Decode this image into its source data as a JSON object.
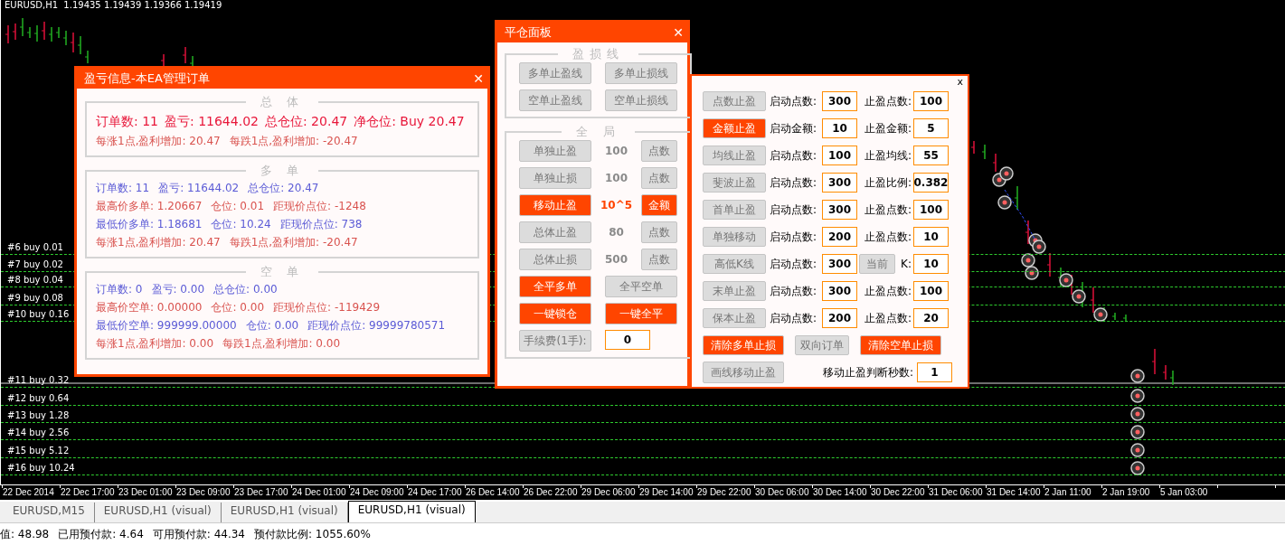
{
  "chart": {
    "title": "EURUSD,H1  1.19435 1.19439 1.19366 1.19419",
    "order_lines": [
      {
        "label": "#6 buy 0.01"
      },
      {
        "label": "#7 buy 0.02"
      },
      {
        "label": "#8 buy 0.04"
      },
      {
        "label": "#9 buy 0.08"
      },
      {
        "label": "#10 buy 0.16"
      },
      {
        "label": "#11 buy 0.32"
      },
      {
        "label": "#12 buy 0.64"
      },
      {
        "label": "#13 buy 1.28"
      },
      {
        "label": "#14 buy 2.56"
      },
      {
        "label": "#15 buy 5.12"
      },
      {
        "label": "#16 buy 10.24"
      }
    ],
    "time_axis": [
      "22 Dec 2014",
      "22 Dec 17:00",
      "23 Dec 01:00",
      "23 Dec 09:00",
      "23 Dec 17:00",
      "24 Dec 01:00",
      "24 Dec 09:00",
      "24 Dec 17:00",
      "26 Dec 14:00",
      "26 Dec 22:00",
      "29 Dec 06:00",
      "29 Dec 14:00",
      "29 Dec 22:00",
      "30 Dec 06:00",
      "30 Dec 14:00",
      "30 Dec 22:00",
      "31 Dec 06:00",
      "31 Dec 14:00",
      "2 Jan 11:00",
      "2 Jan 19:00",
      "5 Jan 03:00"
    ]
  },
  "profit_panel": {
    "title": "盈亏信息-本EA管理订单",
    "close": "✕",
    "sections": [
      {
        "title": "总 体",
        "lines": [
          {
            "kind": "headline",
            "color": "#e8173a",
            "items": [
              "订单数: 11",
              "盈亏: 11644.02",
              "总仓位: 20.47",
              "净仓位: Buy 20.47"
            ]
          },
          {
            "kind": "normal",
            "color": "#d9534f",
            "items": [
              "每涨1点,盈利增加: 20.47",
              "每跌1点,盈利增加: -20.47"
            ]
          }
        ]
      },
      {
        "title": "多 单",
        "lines": [
          {
            "kind": "normal",
            "color": "#5b5bd6",
            "items": [
              "订单数: 11",
              "盈亏: 11644.02",
              "总仓位: 20.47"
            ]
          },
          {
            "kind": "normal",
            "color": "#d9534f",
            "items": [
              "最高价多单: 1.20667",
              "仓位: 0.01",
              "距现价点位: -1248"
            ]
          },
          {
            "kind": "normal",
            "color": "#5b5bd6",
            "items": [
              "最低价多单: 1.18681",
              "仓位: 10.24",
              "距现价点位: 738"
            ]
          },
          {
            "kind": "normal",
            "color": "#d9534f",
            "items": [
              "每涨1点,盈利增加: 20.47",
              "每跌1点,盈利增加: -20.47"
            ]
          }
        ]
      },
      {
        "title": "空 单",
        "lines": [
          {
            "kind": "normal",
            "color": "#5b5bd6",
            "items": [
              "订单数: 0",
              "盈亏: 0.00",
              "总仓位: 0.00"
            ]
          },
          {
            "kind": "normal",
            "color": "#d9534f",
            "items": [
              "最高价空单: 0.00000",
              "仓位: 0.00",
              "距现价点位: -119429"
            ]
          },
          {
            "kind": "normal",
            "color": "#5b5bd6",
            "items": [
              "最低价空单: 999999.00000",
              "仓位: 0.00",
              "距现价点位: 99999780571"
            ]
          },
          {
            "kind": "normal",
            "color": "#d9534f",
            "items": [
              "每涨1点,盈利增加: 0.00",
              "每跌1点,盈利增加: 0.00"
            ]
          }
        ]
      }
    ]
  },
  "close_panel": {
    "title": "平仓面板",
    "close": "✕",
    "line_group": {
      "title": "盈损线",
      "buttons": [
        {
          "label": "多单止盈线",
          "active": false
        },
        {
          "label": "多单止损线",
          "active": false
        },
        {
          "label": "空单止盈线",
          "active": false
        },
        {
          "label": "空单止损线",
          "active": false
        }
      ]
    },
    "global_group": {
      "title": "全 局",
      "rows": [
        {
          "button": {
            "label": "单独止盈",
            "active": false
          },
          "value": "100",
          "unit": {
            "label": "点数",
            "active": false
          }
        },
        {
          "button": {
            "label": "单独止损",
            "active": false
          },
          "value": "100",
          "unit": {
            "label": "点数",
            "active": false
          }
        },
        {
          "button": {
            "label": "移动止盈",
            "active": true
          },
          "value": "10^5",
          "unit": {
            "label": "金额",
            "active": true
          }
        },
        {
          "button": {
            "label": "总体止盈",
            "active": false
          },
          "value": "80",
          "unit": {
            "label": "点数",
            "active": false
          }
        },
        {
          "button": {
            "label": "总体止损",
            "active": false
          },
          "value": "500",
          "unit": {
            "label": "点数",
            "active": false
          }
        }
      ],
      "actions": [
        {
          "label": "全平多单",
          "active": true
        },
        {
          "label": "全平空单",
          "active": false
        },
        {
          "label": "一键锁仓",
          "active": true
        },
        {
          "label": "一键全平",
          "active": true
        }
      ],
      "fee": {
        "label": "手续费(1手):",
        "value": "0"
      }
    }
  },
  "stop_panel": {
    "close": "x",
    "rows": [
      {
        "button": {
          "label": "点数止盈",
          "active": false
        },
        "start_label": "启动点数:",
        "start_value": "300",
        "target_label": "止盈点数:",
        "target_value": "100"
      },
      {
        "button": {
          "label": "金额止盈",
          "active": true
        },
        "start_label": "启动金额:",
        "start_value": "10",
        "target_label": "止盈金额:",
        "target_value": "5"
      },
      {
        "button": {
          "label": "均线止盈",
          "active": false
        },
        "start_label": "启动点数:",
        "start_value": "100",
        "target_label": "止盈均线:",
        "target_value": "55"
      },
      {
        "button": {
          "label": "斐波止盈",
          "active": false
        },
        "start_label": "启动点数:",
        "start_value": "300",
        "target_label": "止盈比例:",
        "target_value": "0.382"
      },
      {
        "button": {
          "label": "首单止盈",
          "active": false
        },
        "start_label": "启动点数:",
        "start_value": "300",
        "target_label": "止盈点数:",
        "target_value": "100"
      },
      {
        "button": {
          "label": "单独移动",
          "active": false
        },
        "start_label": "启动点数:",
        "start_value": "200",
        "target_label": "止盈点数:",
        "target_value": "10"
      },
      {
        "button": {
          "label": "高低K线",
          "active": false
        },
        "start_label": "启动点数:",
        "start_value": "300",
        "target_button": {
          "label": "当前",
          "active": false
        },
        "target_label": "K:",
        "target_value": "10"
      },
      {
        "button": {
          "label": "末单止盈",
          "active": false
        },
        "start_label": "启动点数:",
        "start_value": "300",
        "target_label": "止盈点数:",
        "target_value": "100"
      },
      {
        "button": {
          "label": "保本止盈",
          "active": false
        },
        "start_label": "启动点数:",
        "start_value": "200",
        "target_label": "止盈点数:",
        "target_value": "20"
      }
    ],
    "actions": [
      {
        "label": "清除多单止损",
        "active": true
      },
      {
        "label": "双向订单",
        "active": false
      },
      {
        "label": "清除空单止损",
        "active": true
      }
    ],
    "draw_button": {
      "label": "画线移动止盈",
      "active": false
    },
    "seconds_label": "移动止盈判断秒数:",
    "seconds_value": "1"
  },
  "tabs": [
    {
      "label": "EURUSD,M15",
      "selected": false
    },
    {
      "label": "EURUSD,H1 (visual)",
      "selected": false
    },
    {
      "label": "EURUSD,H1 (visual)",
      "selected": false
    },
    {
      "label": "EURUSD,H1 (visual)",
      "selected": true
    }
  ],
  "status_bar": [
    "值: 48.98",
    "已用预付款: 4.64",
    "可用预付款: 44.34",
    "预付款比例: 1055.60%"
  ]
}
